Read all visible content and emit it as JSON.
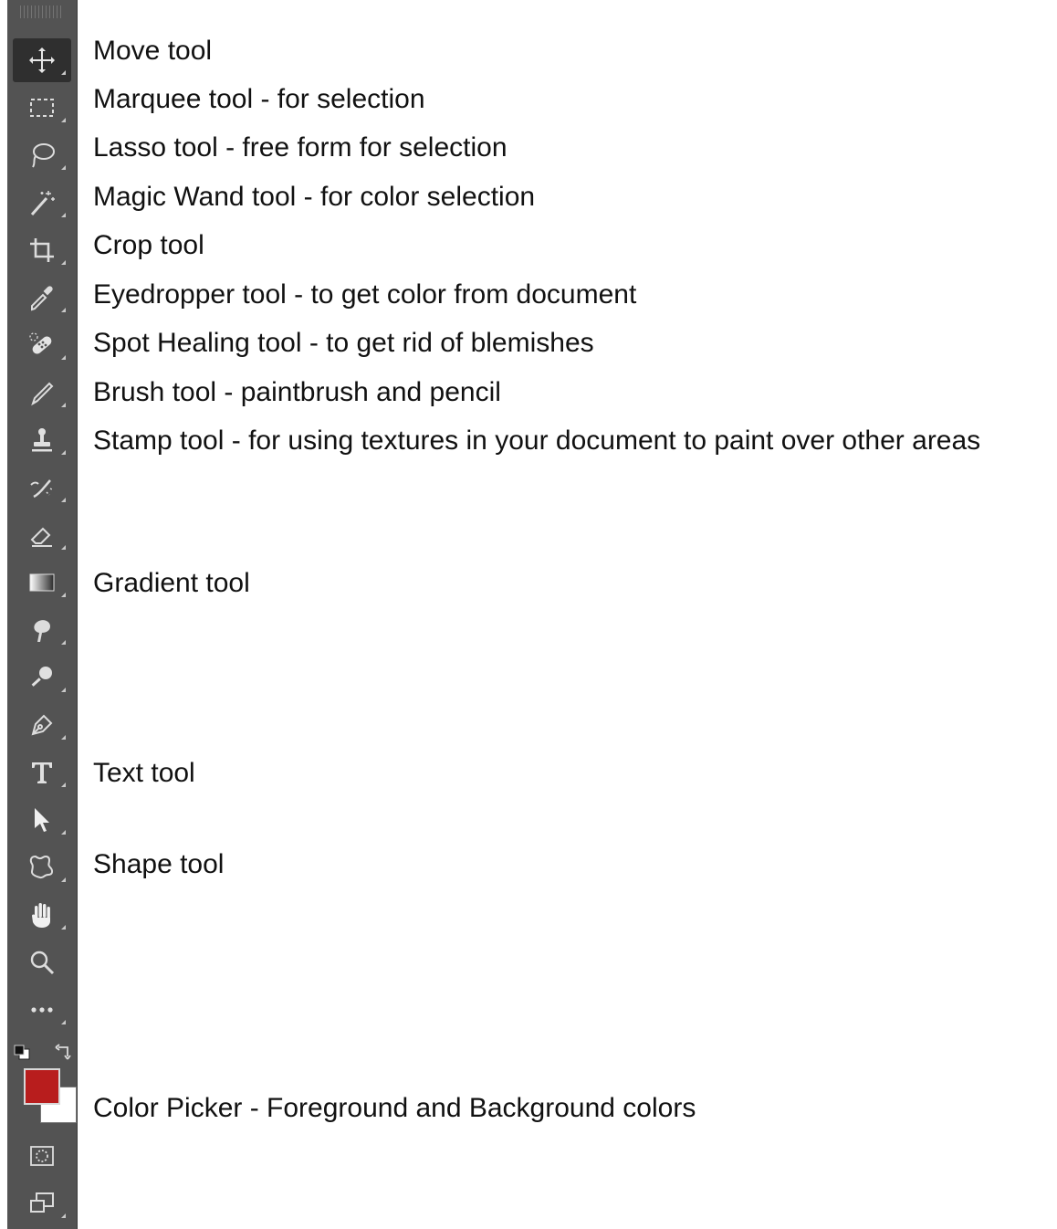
{
  "toolbar": {
    "tools": [
      {
        "icon": "move-icon",
        "label": "Move tool",
        "active": true
      },
      {
        "icon": "marquee-icon",
        "label": "Marquee tool - for selection"
      },
      {
        "icon": "lasso-icon",
        "label": "Lasso tool - free form for selection"
      },
      {
        "icon": "magic-wand-icon",
        "label": "Magic Wand tool - for color selection"
      },
      {
        "icon": "crop-icon",
        "label": "Crop tool"
      },
      {
        "icon": "eyedropper-icon",
        "label": "Eyedropper tool - to get color from document"
      },
      {
        "icon": "spot-healing-icon",
        "label": "Spot Healing tool - to get rid of blemishes"
      },
      {
        "icon": "brush-icon",
        "label": "Brush tool - paintbrush and pencil"
      },
      {
        "icon": "stamp-icon",
        "label": "Stamp tool - for using textures in your document to paint over other areas"
      },
      {
        "icon": "history-brush-icon",
        "label": ""
      },
      {
        "icon": "eraser-icon",
        "label": ""
      },
      {
        "icon": "gradient-icon",
        "label": "Gradient tool"
      },
      {
        "icon": "smudge-icon",
        "label": ""
      },
      {
        "icon": "dodge-icon",
        "label": ""
      },
      {
        "icon": "pen-icon",
        "label": ""
      },
      {
        "icon": "text-icon",
        "label": "Text tool"
      },
      {
        "icon": "path-selection-icon",
        "label": ""
      },
      {
        "icon": "shape-icon",
        "label": "Shape tool"
      },
      {
        "icon": "hand-icon",
        "label": ""
      },
      {
        "icon": "zoom-icon",
        "label": ""
      },
      {
        "icon": "more-tools-icon",
        "label": ""
      }
    ],
    "color_picker": {
      "label": "Color Picker - Foreground and Background colors",
      "foreground": "#b81d1d",
      "background": "#ffffff"
    },
    "bottom_icons": [
      "quick-mask-icon",
      "screen-mode-icon"
    ]
  }
}
